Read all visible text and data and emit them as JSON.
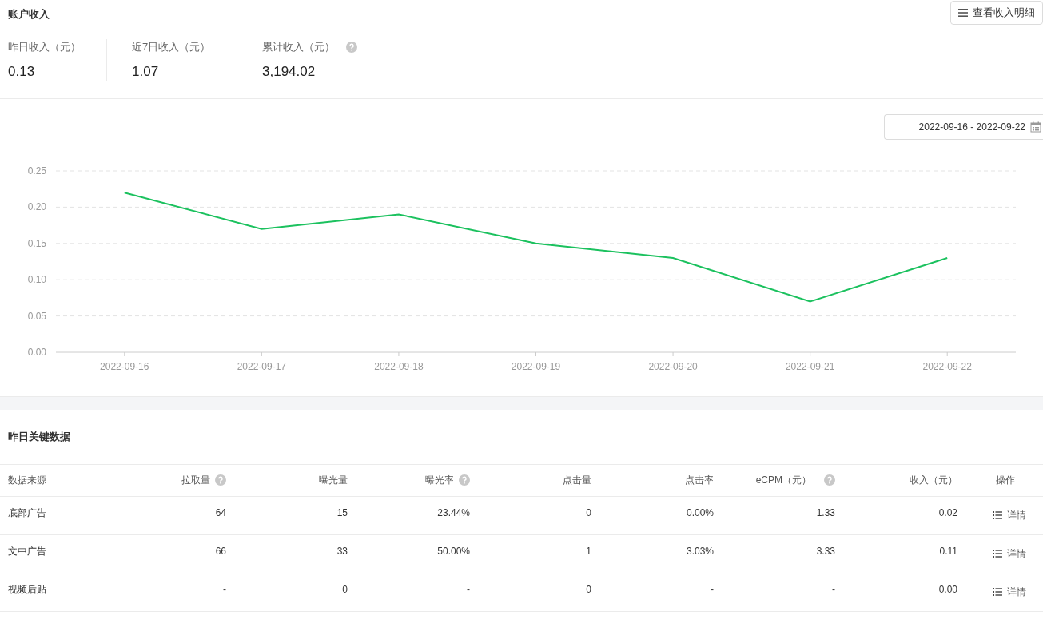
{
  "account": {
    "title": "账户收入",
    "detail_button": "查看收入明细",
    "stats": [
      {
        "label": "昨日收入（元）",
        "value": "0.13",
        "help": false
      },
      {
        "label": "近7日收入（元）",
        "value": "1.07",
        "help": false
      },
      {
        "label": "累计收入（元）",
        "value": "3,194.02",
        "help": true
      }
    ]
  },
  "date_range": "2022-09-16 - 2022-09-22",
  "chart": {
    "chart_data": {
      "type": "line",
      "categories": [
        "2022-09-16",
        "2022-09-17",
        "2022-09-18",
        "2022-09-19",
        "2022-09-20",
        "2022-09-21",
        "2022-09-22"
      ],
      "grid": true,
      "series": [
        {
          "color": "#1bc15e",
          "values": [
            0.22,
            0.17,
            0.19,
            0.15,
            0.13,
            0.07,
            0.13
          ]
        }
      ],
      "ylim": [
        0,
        0.25
      ],
      "yticks": [
        {
          "value": 0,
          "label": "0.00"
        },
        {
          "value": 0.05,
          "label": "0.05"
        },
        {
          "value": 0.1,
          "label": "0.10"
        },
        {
          "value": 0.15,
          "label": "0.15"
        },
        {
          "value": 0.2,
          "label": "0.20"
        },
        {
          "value": 0.25,
          "label": "0.25"
        }
      ]
    }
  },
  "table": {
    "title": "昨日关键数据",
    "columns": [
      {
        "label": "数据来源",
        "help": false
      },
      {
        "label": "拉取量",
        "help": true
      },
      {
        "label": "曝光量",
        "help": false
      },
      {
        "label": "曝光率",
        "help": true
      },
      {
        "label": "点击量",
        "help": false
      },
      {
        "label": "点击率",
        "help": false
      },
      {
        "label": "eCPM（元）",
        "help": true
      },
      {
        "label": "收入（元）",
        "help": false
      },
      {
        "label": "操作",
        "help": false
      }
    ],
    "rows": [
      {
        "cells": [
          "底部广告",
          "64",
          "15",
          "23.44%",
          "0",
          "0.00%",
          "1.33",
          "0.02"
        ],
        "action": "详情"
      },
      {
        "cells": [
          "文中广告",
          "66",
          "33",
          "50.00%",
          "1",
          "3.03%",
          "3.33",
          "0.11"
        ],
        "action": "详情"
      },
      {
        "cells": [
          "视频后贴",
          "-",
          "0",
          "-",
          "0",
          "-",
          "-",
          "0.00"
        ],
        "action": "详情"
      }
    ]
  }
}
